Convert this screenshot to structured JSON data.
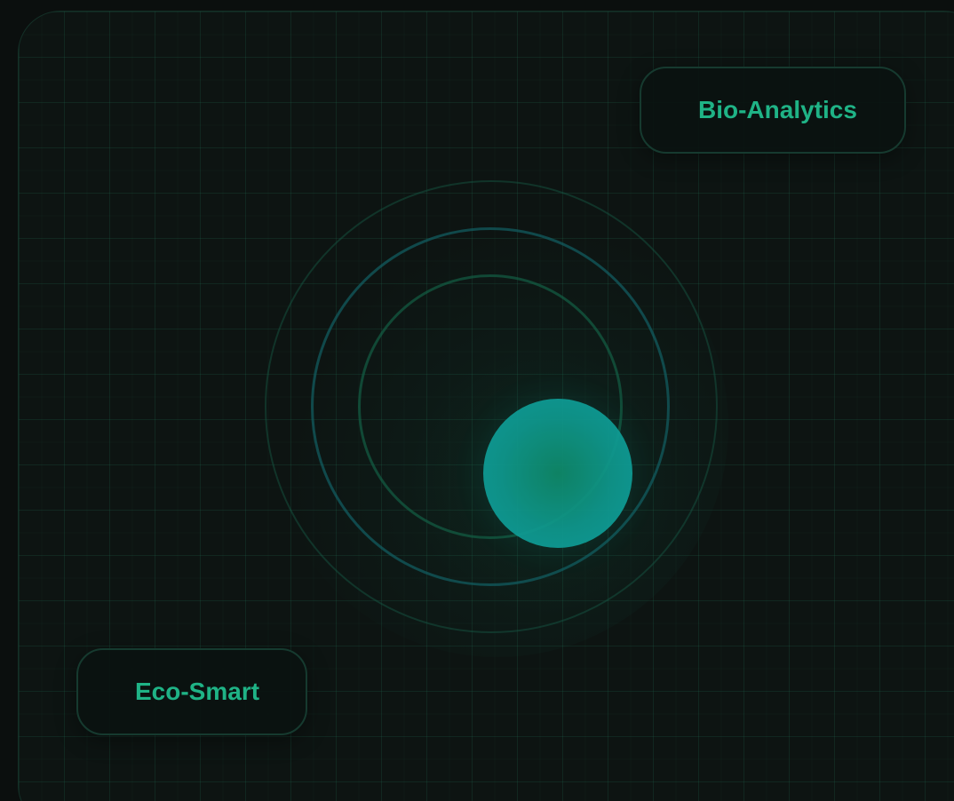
{
  "badges": {
    "top_right": "Bio-Analytics",
    "bottom_left": "Eco-Smart"
  },
  "colors": {
    "background": "#0b0f0e",
    "panel": "#0d1412",
    "accent_text": "#1fb386",
    "orb": "#0f9a90",
    "ring_teal": "#125f64",
    "ring_green": "#14644a"
  }
}
